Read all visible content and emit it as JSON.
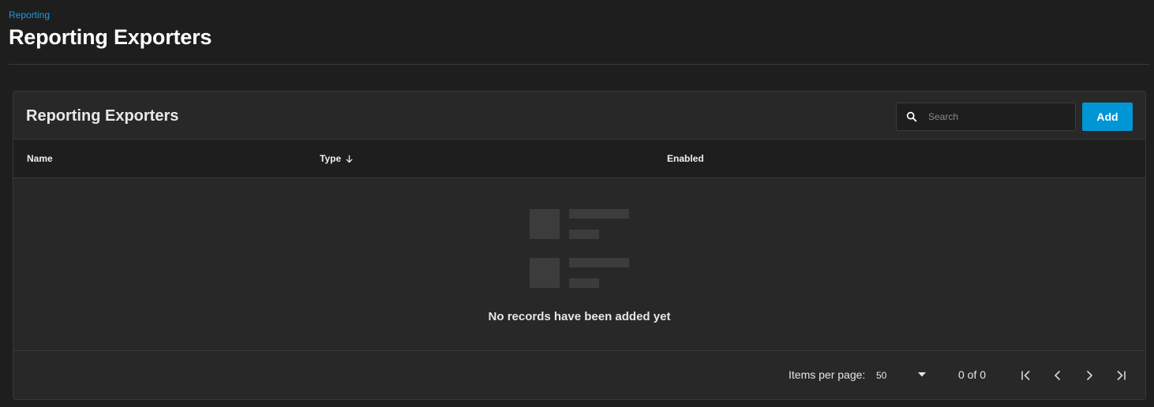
{
  "breadcrumb": "Reporting",
  "page_title": "Reporting Exporters",
  "card": {
    "title": "Reporting Exporters",
    "search_placeholder": "Search",
    "add_label": "Add"
  },
  "table": {
    "columns": [
      {
        "label": "Name"
      },
      {
        "label": "Type",
        "sort": "descending"
      },
      {
        "label": "Enabled"
      }
    ],
    "empty_message": "No records have been added yet"
  },
  "paginator": {
    "items_per_page_label": "Items per page:",
    "items_per_page_value": "50",
    "range_label": "0 of 0"
  },
  "colors": {
    "accent": "#0095d5",
    "breadcrumb": "#1a9de0",
    "background": "#1e1e1e",
    "card": "#282828"
  },
  "icons": [
    "search-icon",
    "arrow-down-icon",
    "chevron-down-icon",
    "first-page-icon",
    "chevron-left-icon",
    "chevron-right-icon",
    "last-page-icon"
  ]
}
